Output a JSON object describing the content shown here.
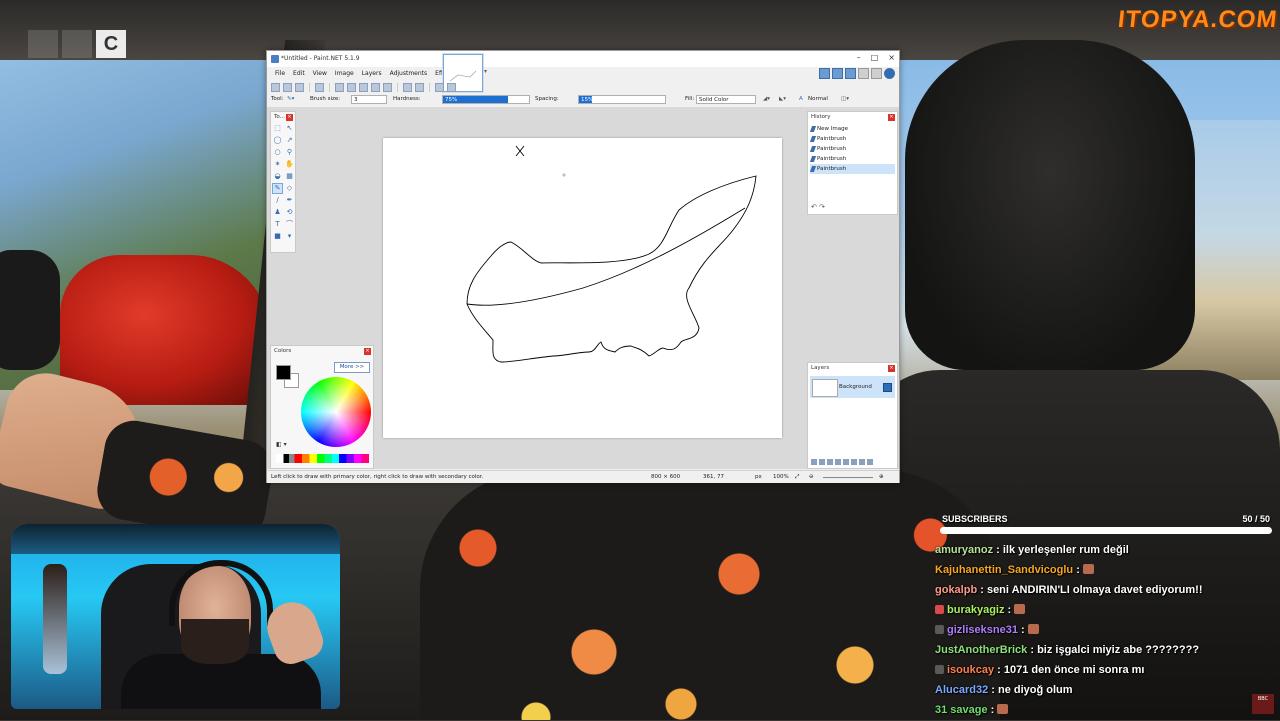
{
  "channel": {
    "corner_logo": "BBC",
    "sponsor": "ITOPYA.COM"
  },
  "paintnet": {
    "title": "*Untitled - Paint.NET 5.1.9",
    "menu": [
      "File",
      "Edit",
      "View",
      "Image",
      "Layers",
      "Adjustments",
      "Effects"
    ],
    "toolbar": {
      "tool_label": "Tool:",
      "brush_size_label": "Brush size:",
      "brush_size_value": "3",
      "hardness_label": "Hardness:",
      "hardness_value": "75%",
      "hardness_level": 0.75,
      "spacing_label": "Spacing:",
      "spacing_value": "15%",
      "spacing_level": 0.15,
      "fill_label": "Fill:",
      "fill_value": "Solid Color",
      "blend_value": "Normal"
    },
    "tools_panel": {
      "title": "To..."
    },
    "colors_panel": {
      "title": "Colors",
      "more_button": "More >>"
    },
    "history_panel": {
      "title": "History",
      "items": [
        "New Image",
        "Paintbrush",
        "Paintbrush",
        "Paintbrush",
        "Paintbrush"
      ]
    },
    "layers_panel": {
      "title": "Layers",
      "layer_name": "Background"
    },
    "status": {
      "hint": "Left click to draw with primary color, right click to draw with secondary color.",
      "image_size": "800 × 600",
      "cursor_pos": "361, 77",
      "units": "px",
      "zoom": "100%"
    },
    "colors": {
      "primary": "#000000",
      "secondary": "#ffffff",
      "accent": "#1e6fd1"
    }
  },
  "subscribers": {
    "label": "SUBSCRIBERS",
    "count_text": "50 / 50",
    "progress": 1.0
  },
  "chat": [
    {
      "user": "amuryanoz",
      "color": "#b8e29a",
      "badge": "",
      "text": " : ilk yerleşenler rum değil",
      "emote": false
    },
    {
      "user": "Kajuhanettin_Sandvicoglu",
      "color": "#f5a623",
      "badge": "",
      "text": " :",
      "emote": true
    },
    {
      "user": "gokalpb",
      "color": "#ff9a8a",
      "badge": "",
      "text": " : seni ANDIRIN'LI olmaya davet ediyorum!!",
      "emote": false
    },
    {
      "user": "burakyagiz",
      "color": "#a8f060",
      "badge": "#d94b4b",
      "text": " :",
      "emote": true
    },
    {
      "user": "gizliseksne31",
      "color": "#b07cff",
      "badge": "#5a5a5a",
      "text": " :",
      "emote": true
    },
    {
      "user": "JustAnotherBrick",
      "color": "#8de07a",
      "badge": "",
      "text": " : biz işgalci miyiz abe ????????",
      "emote": false
    },
    {
      "user": "isoukcay",
      "color": "#ff7f50",
      "badge": "#5a5a5a",
      "text": " : 1071 den önce mi sonra mı",
      "emote": false
    },
    {
      "user": "Alucard32",
      "color": "#7aa8ff",
      "badge": "",
      "text": " : ne diyoğ olum",
      "emote": false
    },
    {
      "user": "31 savage",
      "color": "#6fdc6f",
      "badge": "",
      "text": " :",
      "emote": true
    }
  ]
}
